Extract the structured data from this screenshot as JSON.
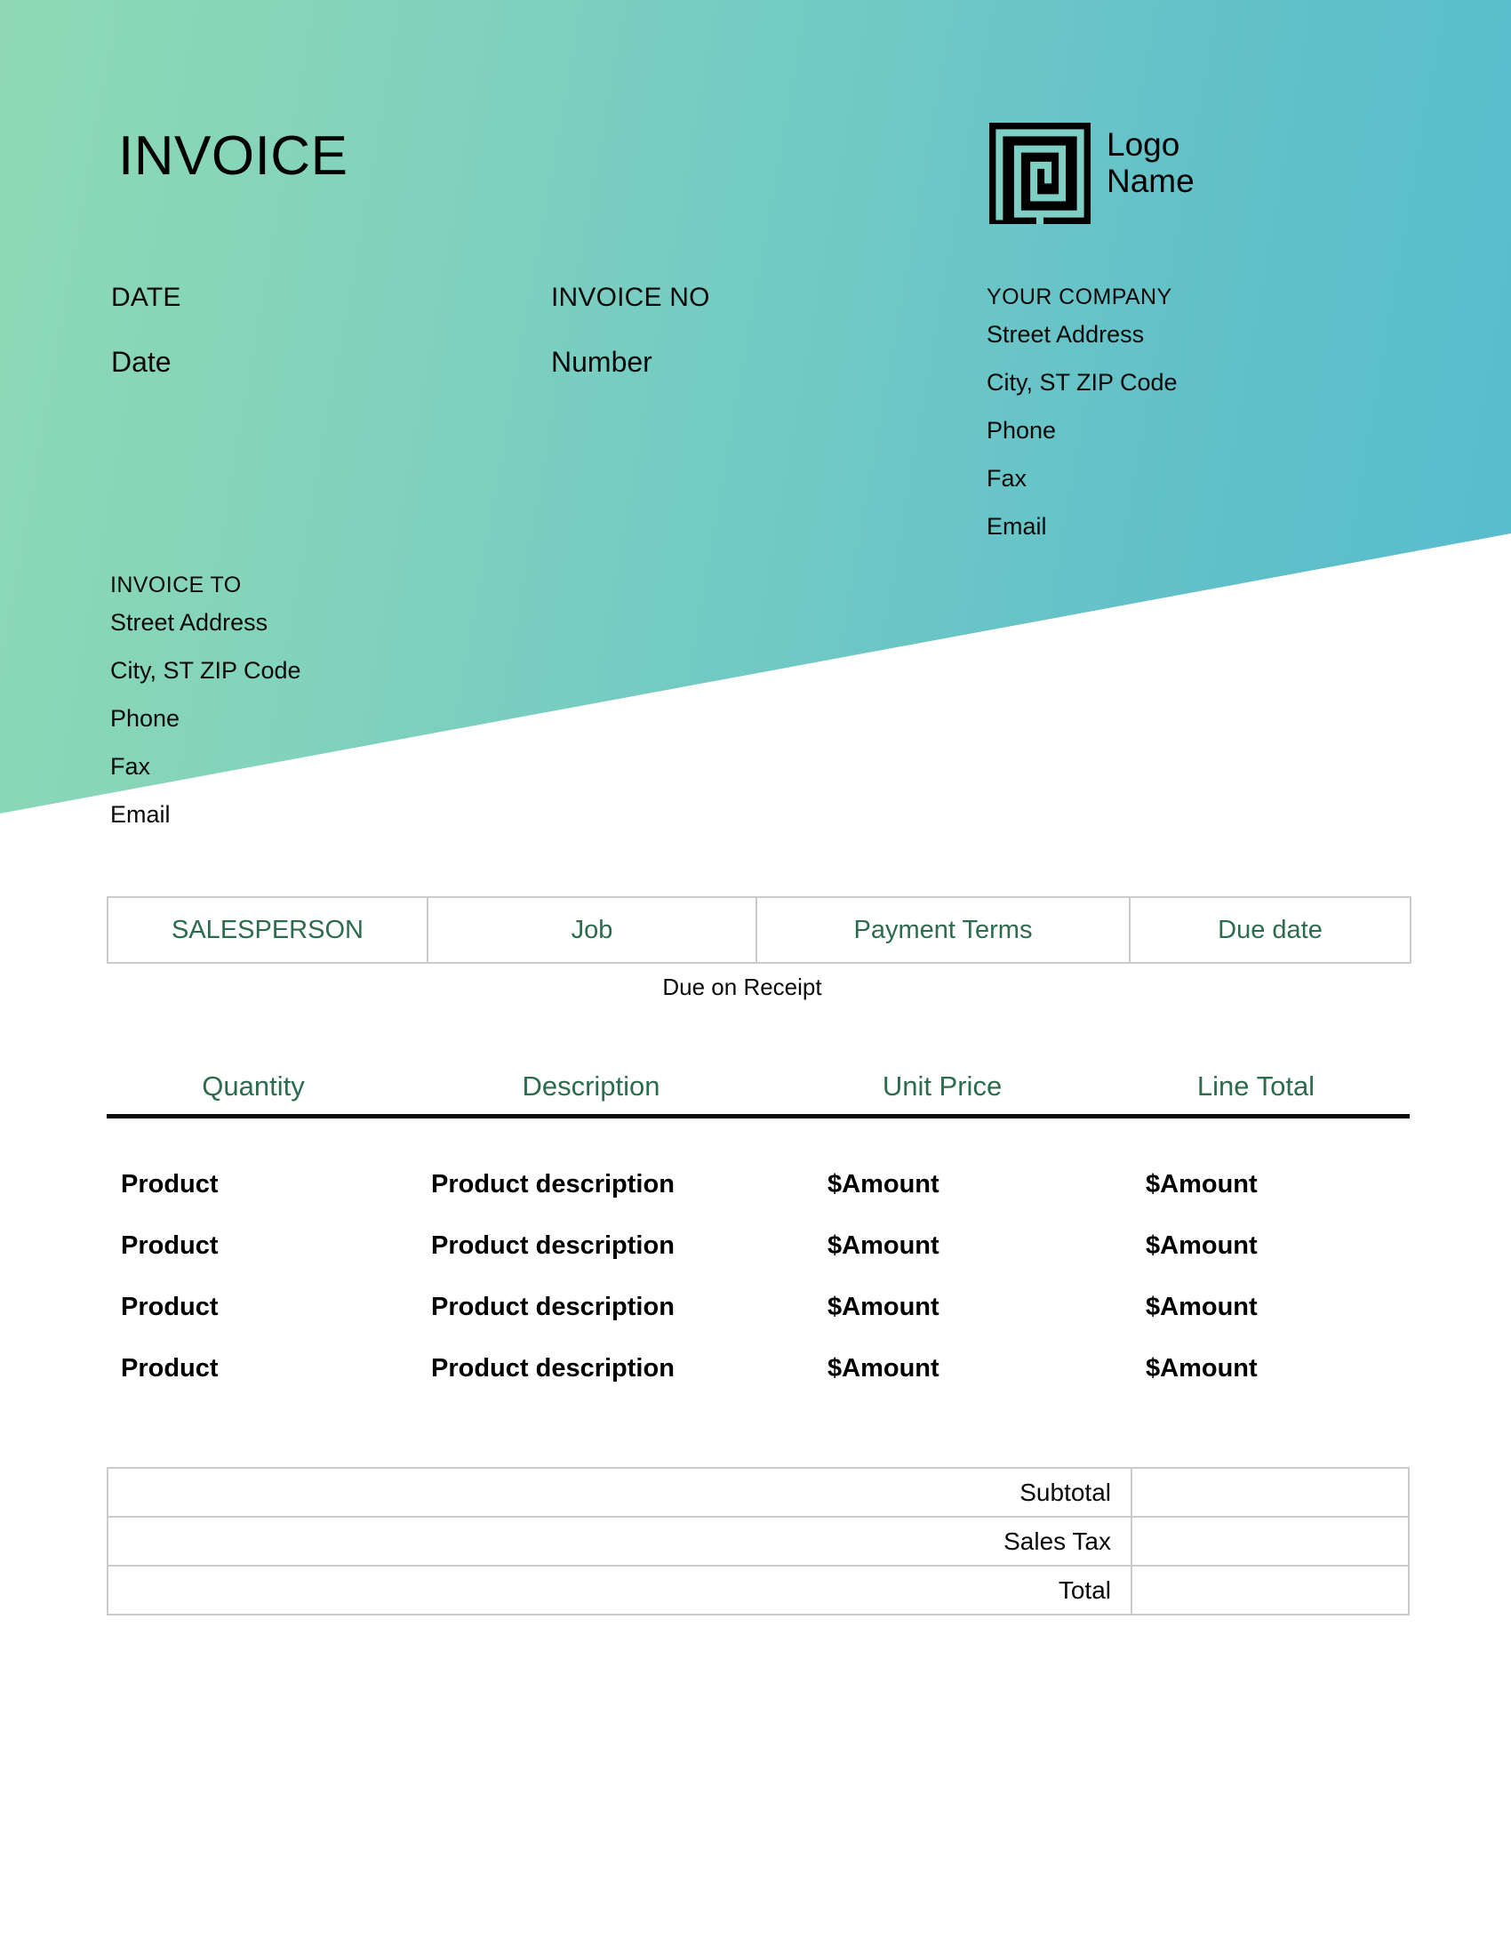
{
  "document": {
    "title": "INVOICE"
  },
  "meta": {
    "date_label": "DATE",
    "date_value": "Date",
    "invoice_no_label": "INVOICE NO",
    "invoice_no_value": "Number"
  },
  "logo": {
    "icon": "labyrinth-square-logo-icon",
    "line1": "Logo",
    "line2": "Name"
  },
  "company": {
    "heading": "YOUR COMPANY",
    "lines": [
      "Street Address",
      "City, ST ZIP Code",
      "Phone",
      "Fax",
      "Email"
    ]
  },
  "bill_to": {
    "heading": "INVOICE TO",
    "lines": [
      "Street Address",
      "City, ST ZIP Code",
      "Phone",
      "Fax",
      "Email"
    ]
  },
  "sales_table": {
    "headers": [
      "SALESPERSON",
      "Job",
      "Payment Terms",
      "Due date"
    ],
    "note": "Due on Receipt"
  },
  "line_items": {
    "headers": [
      "Quantity",
      "Description",
      "Unit Price",
      "Line Total"
    ],
    "rows": [
      {
        "quantity": "Product",
        "description": "Product description",
        "unit_price": "$Amount",
        "line_total": "$Amount"
      },
      {
        "quantity": "Product",
        "description": "Product description",
        "unit_price": "$Amount",
        "line_total": "$Amount"
      },
      {
        "quantity": "Product",
        "description": "Product description",
        "unit_price": "$Amount",
        "line_total": "$Amount"
      },
      {
        "quantity": "Product",
        "description": "Product description",
        "unit_price": "$Amount",
        "line_total": "$Amount"
      }
    ]
  },
  "totals": {
    "rows": [
      {
        "label": "Subtotal",
        "value": ""
      },
      {
        "label": "Sales Tax",
        "value": ""
      },
      {
        "label": "Total",
        "value": ""
      }
    ]
  },
  "colors": {
    "gradient_start": "#8ED9B4",
    "gradient_end": "#57BCCD",
    "header_green": "#2C6B4F",
    "border_gray": "#c9cbcd",
    "text_black": "#0a0a0a"
  }
}
